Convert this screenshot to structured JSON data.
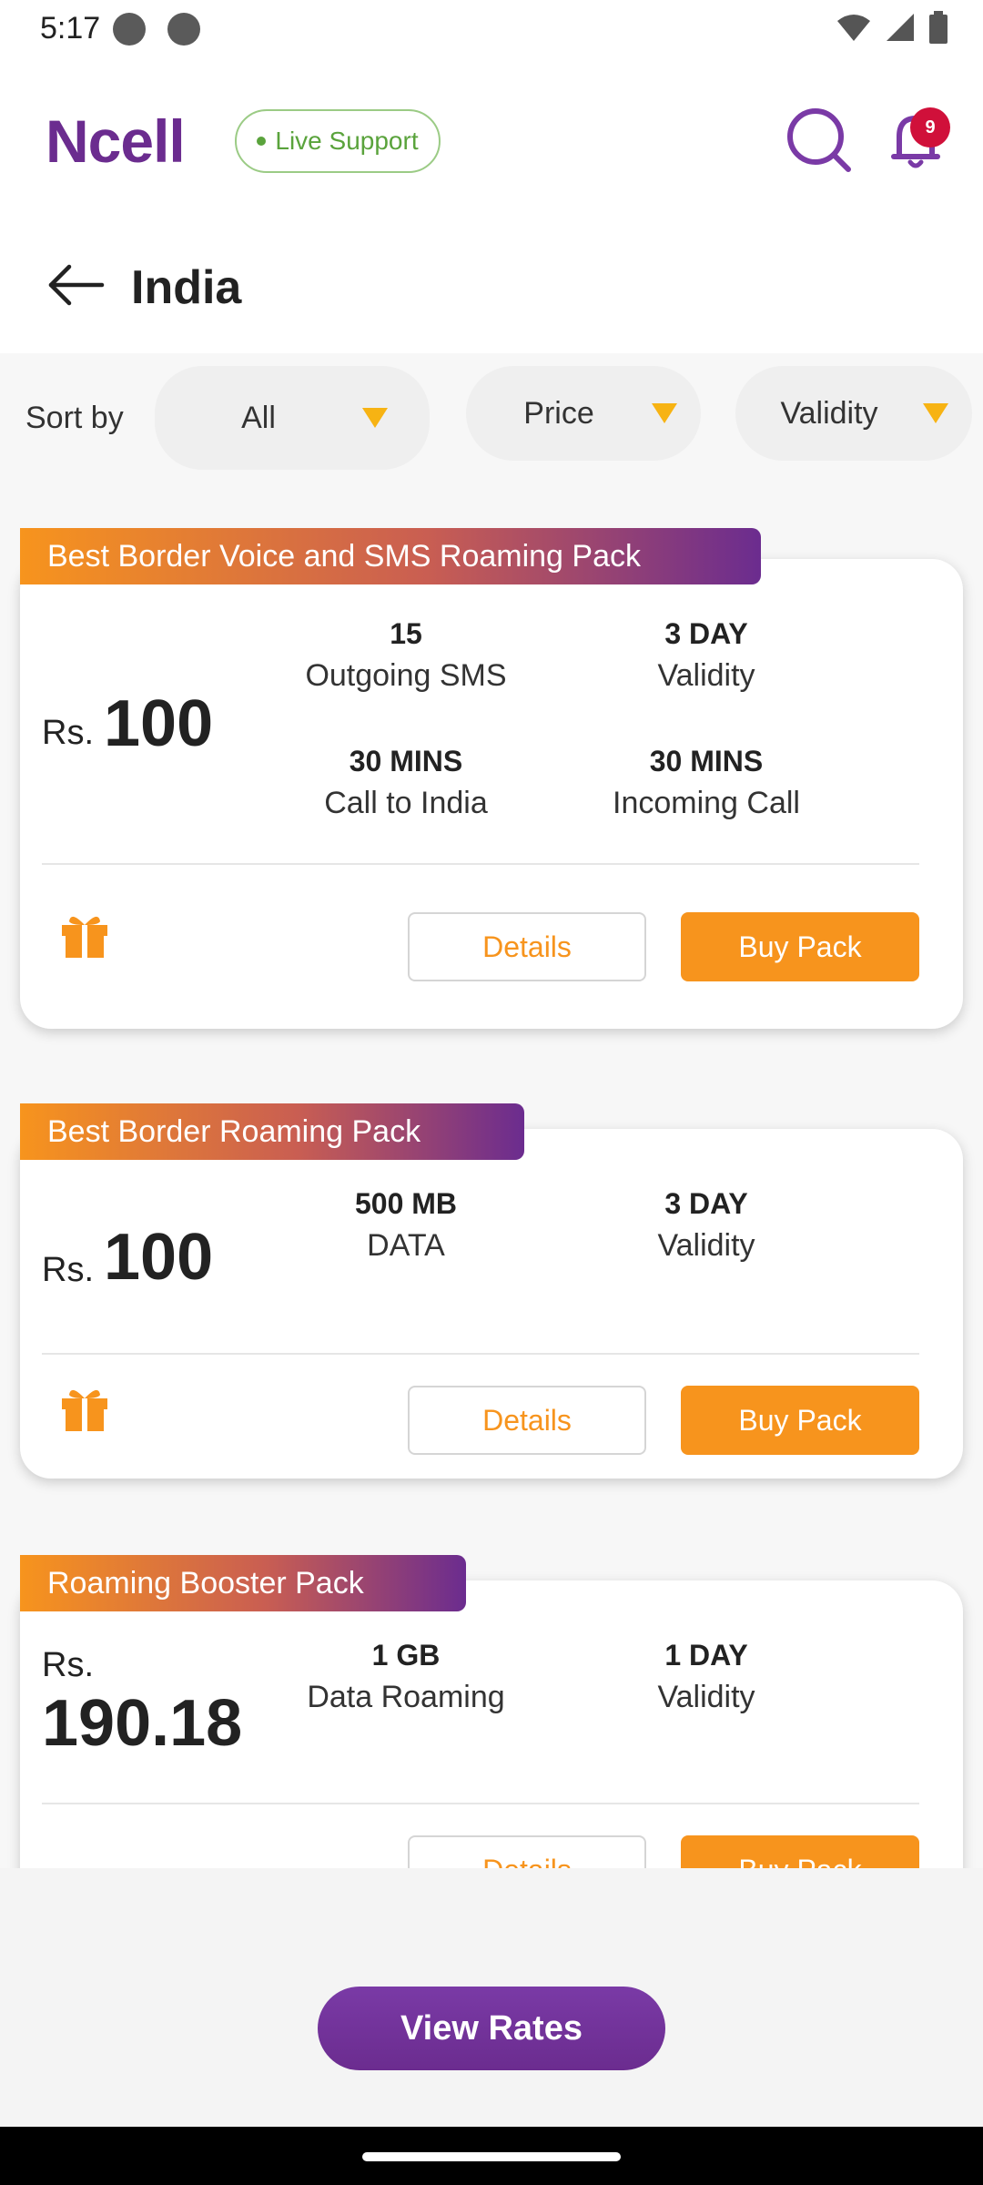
{
  "status_bar": {
    "time": "5:17"
  },
  "header": {
    "logo": "Ncell",
    "live_support": "Live Support",
    "notification_count": "9"
  },
  "page": {
    "title": "India"
  },
  "sort": {
    "label": "Sort by",
    "filters": [
      {
        "label": "All"
      },
      {
        "label": "Price"
      },
      {
        "label": "Validity"
      }
    ]
  },
  "packs": [
    {
      "name": "Best Border Voice and SMS Roaming Pack",
      "currency": "Rs.",
      "price": "100",
      "features": [
        {
          "value": "15",
          "label": "Outgoing SMS"
        },
        {
          "value": "3 DAY",
          "label": "Validity"
        },
        {
          "value": "30 MINS",
          "label": "Call to India"
        },
        {
          "value": "30 MINS",
          "label": "Incoming Call"
        }
      ],
      "details_label": "Details",
      "buy_label": "Buy Pack"
    },
    {
      "name": "Best Border Roaming Pack",
      "currency": "Rs.",
      "price": "100",
      "features": [
        {
          "value": "500 MB",
          "label": "DATA"
        },
        {
          "value": "3 DAY",
          "label": "Validity"
        }
      ],
      "details_label": "Details",
      "buy_label": "Buy Pack"
    },
    {
      "name": "Roaming Booster Pack",
      "currency": "Rs.",
      "price": "190.18",
      "features": [
        {
          "value": "1 GB",
          "label": "Data Roaming"
        },
        {
          "value": "1 DAY",
          "label": "Validity"
        }
      ],
      "details_label": "Details",
      "buy_label": "Buy Pack"
    }
  ],
  "footer": {
    "view_rates": "View Rates"
  },
  "colors": {
    "brand": "#6b2c8f",
    "accent": "#f7941d",
    "live": "#5aa33c",
    "badge": "#d0103a"
  }
}
